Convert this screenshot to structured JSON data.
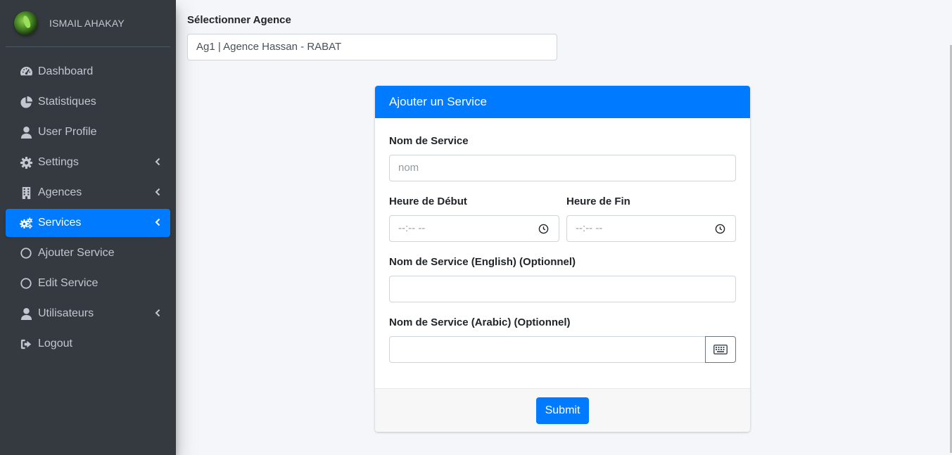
{
  "sidebar": {
    "user_name": "ISMAIL AHAKAY",
    "items": [
      {
        "label": "Dashboard",
        "icon": "tachometer-icon"
      },
      {
        "label": "Statistiques",
        "icon": "pie-chart-icon"
      },
      {
        "label": "User Profile",
        "icon": "user-icon"
      },
      {
        "label": "Settings",
        "icon": "gear-icon"
      },
      {
        "label": "Agences",
        "icon": "building-icon"
      },
      {
        "label": "Services",
        "icon": "gears-icon",
        "active": true
      },
      {
        "label": "Ajouter Service",
        "icon": "circle-icon"
      },
      {
        "label": "Edit Service",
        "icon": "circle-icon"
      },
      {
        "label": "Utilisateurs",
        "icon": "user-icon"
      },
      {
        "label": "Logout",
        "icon": "sign-out-icon"
      }
    ]
  },
  "agency": {
    "label": "Sélectionner Agence",
    "selected": "Ag1 | Agence Hassan - RABAT"
  },
  "form": {
    "title": "Ajouter un Service",
    "name_label": "Nom de Service",
    "name_placeholder": "nom",
    "start_label": "Heure de Début",
    "end_label": "Heure de Fin",
    "time_placeholder": "--:-- --",
    "english_label": "Nom de Service (English) (Optionnel)",
    "arabic_label": "Nom de Service (Arabic) (Optionnel)",
    "submit": "Submit"
  },
  "colors": {
    "sidebar_bg": "#343a40",
    "accent": "#007bff",
    "page_bg": "#f4f6f9"
  }
}
